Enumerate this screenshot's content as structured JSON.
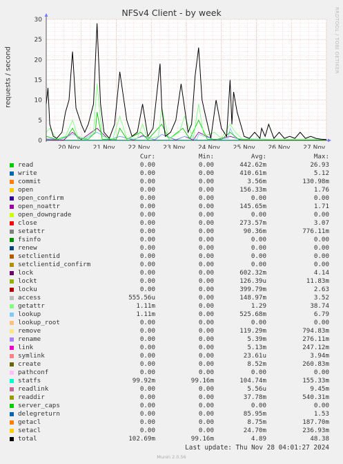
{
  "title": "NFSv4 Client - by week",
  "ylabel": "requests / second",
  "side_text": "RRDTOOL / TOBI OETIKER",
  "headers": {
    "cur": "Cur:",
    "min": "Min:",
    "avg": "Avg:",
    "max": "Max:"
  },
  "footer": "Last update: Thu Nov 28 04:01:27 2024",
  "version": "Munin 2.0.56",
  "legend": [
    {
      "name": "read",
      "color": "#00cc00",
      "cur": "0.00",
      "min": "0.00",
      "avg": "442.62m",
      "max": "26.93"
    },
    {
      "name": "write",
      "color": "#0066b3",
      "cur": "0.00",
      "min": "0.00",
      "avg": "410.61m",
      "max": "5.12"
    },
    {
      "name": "commit",
      "color": "#ff8000",
      "cur": "0.00",
      "min": "0.00",
      "avg": "3.56m",
      "max": "130.98m"
    },
    {
      "name": "open",
      "color": "#ffcc00",
      "cur": "0.00",
      "min": "0.00",
      "avg": "156.33m",
      "max": "1.76"
    },
    {
      "name": "open_confirm",
      "color": "#330099",
      "cur": "0.00",
      "min": "0.00",
      "avg": "0.00",
      "max": "0.00"
    },
    {
      "name": "open_noattr",
      "color": "#990099",
      "cur": "0.00",
      "min": "0.00",
      "avg": "145.65m",
      "max": "1.71"
    },
    {
      "name": "open_downgrade",
      "color": "#ccff00",
      "cur": "0.00",
      "min": "0.00",
      "avg": "0.00",
      "max": "0.00"
    },
    {
      "name": "close",
      "color": "#ff0000",
      "cur": "0.00",
      "min": "0.00",
      "avg": "273.57m",
      "max": "3.07"
    },
    {
      "name": "setattr",
      "color": "#808080",
      "cur": "0.00",
      "min": "0.00",
      "avg": "90.36m",
      "max": "776.11m"
    },
    {
      "name": "fsinfo",
      "color": "#008f00",
      "cur": "0.00",
      "min": "0.00",
      "avg": "0.00",
      "max": "0.00"
    },
    {
      "name": "renew",
      "color": "#00487d",
      "cur": "0.00",
      "min": "0.00",
      "avg": "0.00",
      "max": "0.00"
    },
    {
      "name": "setclientid",
      "color": "#b35a00",
      "cur": "0.00",
      "min": "0.00",
      "avg": "0.00",
      "max": "0.00"
    },
    {
      "name": "setclientid_confirm",
      "color": "#b38f00",
      "cur": "0.00",
      "min": "0.00",
      "avg": "0.00",
      "max": "0.00"
    },
    {
      "name": "lock",
      "color": "#6b006b",
      "cur": "0.00",
      "min": "0.00",
      "avg": "602.32m",
      "max": "4.14"
    },
    {
      "name": "lockt",
      "color": "#8fb300",
      "cur": "0.00",
      "min": "0.00",
      "avg": "126.39u",
      "max": "11.83m"
    },
    {
      "name": "locku",
      "color": "#b30000",
      "cur": "0.00",
      "min": "0.00",
      "avg": "399.79m",
      "max": "2.63"
    },
    {
      "name": "access",
      "color": "#bebebe",
      "cur": "555.56u",
      "min": "0.00",
      "avg": "148.97m",
      "max": "3.52"
    },
    {
      "name": "getattr",
      "color": "#80ff80",
      "cur": "1.11m",
      "min": "0.00",
      "avg": "1.29",
      "max": "38.74"
    },
    {
      "name": "lookup",
      "color": "#80c9ff",
      "cur": "1.11m",
      "min": "0.00",
      "avg": "525.68m",
      "max": "6.79"
    },
    {
      "name": "lookup_root",
      "color": "#ffc080",
      "cur": "0.00",
      "min": "0.00",
      "avg": "0.00",
      "max": "0.00"
    },
    {
      "name": "remove",
      "color": "#ffe680",
      "cur": "0.00",
      "min": "0.00",
      "avg": "119.29m",
      "max": "794.83m"
    },
    {
      "name": "rename",
      "color": "#aa80ff",
      "cur": "0.00",
      "min": "0.00",
      "avg": "5.39m",
      "max": "276.11m"
    },
    {
      "name": "link",
      "color": "#ee00cc",
      "cur": "0.00",
      "min": "0.00",
      "avg": "5.13m",
      "max": "247.12m"
    },
    {
      "name": "symlink",
      "color": "#ff8080",
      "cur": "0.00",
      "min": "0.00",
      "avg": "23.61u",
      "max": "3.94m"
    },
    {
      "name": "create",
      "color": "#666600",
      "cur": "0.00",
      "min": "0.00",
      "avg": "8.52m",
      "max": "260.83m"
    },
    {
      "name": "pathconf",
      "color": "#ffbfff",
      "cur": "0.00",
      "min": "0.00",
      "avg": "0.00",
      "max": "0.00"
    },
    {
      "name": "statfs",
      "color": "#00ffcc",
      "cur": "99.92m",
      "min": "99.16m",
      "avg": "104.74m",
      "max": "155.33m"
    },
    {
      "name": "readlink",
      "color": "#cc6699",
      "cur": "0.00",
      "min": "0.00",
      "avg": "5.56u",
      "max": "9.45m"
    },
    {
      "name": "readdir",
      "color": "#999900",
      "cur": "0.00",
      "min": "0.00",
      "avg": "37.78m",
      "max": "540.31m"
    },
    {
      "name": "server_caps",
      "color": "#00cc00",
      "cur": "0.00",
      "min": "0.00",
      "avg": "0.00",
      "max": "0.00"
    },
    {
      "name": "delegreturn",
      "color": "#0066b3",
      "cur": "0.00",
      "min": "0.00",
      "avg": "85.95m",
      "max": "1.53"
    },
    {
      "name": "getacl",
      "color": "#ff8000",
      "cur": "0.00",
      "min": "0.00",
      "avg": "8.75m",
      "max": "187.70m"
    },
    {
      "name": "setacl",
      "color": "#ffcc00",
      "cur": "0.00",
      "min": "0.00",
      "avg": "24.70m",
      "max": "236.93m"
    },
    {
      "name": "total",
      "color": "#000000",
      "cur": "102.69m",
      "min": "99.16m",
      "avg": "4.89",
      "max": "48.38"
    }
  ],
  "chart_data": {
    "type": "line",
    "title": "NFSv4 Client - by week",
    "ylabel": "requests / second",
    "ylim": [
      0,
      30
    ],
    "yticks": [
      0,
      5,
      10,
      15,
      20,
      25,
      30
    ],
    "categories": [
      "20 Nov",
      "21 Nov",
      "22 Nov",
      "23 Nov",
      "24 Nov",
      "25 Nov",
      "26 Nov",
      "27 Nov"
    ],
    "grid": true,
    "series": [
      {
        "name": "total",
        "color": "#000000",
        "x": [
          0.0,
          0.05,
          0.1,
          0.2,
          0.3,
          0.45,
          0.55,
          0.65,
          0.75,
          0.85,
          1.0,
          1.1,
          1.2,
          1.35,
          1.45,
          1.55,
          1.65,
          1.8,
          1.95,
          2.1,
          2.3,
          2.45,
          2.6,
          2.75,
          2.9,
          3.05,
          3.15,
          3.25,
          3.3,
          3.4,
          3.55,
          3.7,
          3.85,
          3.95,
          4.05,
          4.15,
          4.25,
          4.35,
          4.45,
          4.55,
          4.7,
          4.85,
          5.0,
          5.15,
          5.25,
          5.3,
          5.35,
          5.45,
          5.55,
          5.65,
          5.8,
          5.95,
          6.1,
          6.15,
          6.25,
          6.35,
          6.5,
          6.65,
          6.8,
          6.95,
          7.1,
          7.25,
          7.4,
          7.55,
          7.7,
          7.85,
          8.0
        ],
        "y": [
          9,
          13,
          4,
          1,
          0.5,
          2,
          7,
          10,
          22,
          8,
          4,
          2,
          4,
          9,
          29,
          9,
          2,
          0.5,
          4,
          17,
          5,
          1,
          2,
          9,
          1,
          3,
          11,
          19,
          8,
          1,
          2,
          5,
          14,
          8,
          2,
          4,
          16,
          23,
          10,
          6,
          0.5,
          10,
          3,
          1,
          15,
          4,
          12,
          7,
          4,
          1,
          0.5,
          2,
          0.5,
          3,
          1,
          4,
          0.5,
          2,
          0.5,
          1,
          0.5,
          2,
          0.5,
          1,
          0.5,
          0.3,
          0.2
        ]
      },
      {
        "name": "getattr",
        "color": "#80ff80",
        "x": [
          0.0,
          0.1,
          0.3,
          0.55,
          0.75,
          0.9,
          1.1,
          1.35,
          1.45,
          1.6,
          1.9,
          2.1,
          2.3,
          2.6,
          2.75,
          2.9,
          3.2,
          3.3,
          3.5,
          3.8,
          3.95,
          4.2,
          4.35,
          4.5,
          4.8,
          5.0,
          5.25,
          5.4,
          5.6,
          6.0,
          6.3,
          6.6,
          7.0,
          7.5,
          8.0
        ],
        "y": [
          2,
          3,
          0.3,
          1,
          5,
          1,
          0.5,
          2,
          14,
          1,
          0.3,
          6,
          0.5,
          0.5,
          4,
          0.3,
          1,
          8,
          0.3,
          2,
          6,
          0.5,
          9,
          1,
          2,
          0.5,
          4,
          2,
          0.3,
          0.5,
          0.3,
          0.4,
          0.3,
          0.4,
          0.2
        ]
      },
      {
        "name": "read",
        "color": "#00cc00",
        "x": [
          0.0,
          0.3,
          0.6,
          0.75,
          0.9,
          1.2,
          1.4,
          1.45,
          1.6,
          2.0,
          2.1,
          2.3,
          2.7,
          2.9,
          3.3,
          3.5,
          3.9,
          4.1,
          4.35,
          4.6,
          5.0,
          5.25,
          5.5,
          6.0,
          7.0,
          8.0
        ],
        "y": [
          1,
          0.2,
          1,
          3,
          0.5,
          0.3,
          2,
          7,
          0.3,
          0.2,
          3,
          0.3,
          2,
          0.2,
          4,
          0.3,
          3,
          0.4,
          5,
          0.3,
          0.2,
          2,
          0.2,
          0.1,
          0.1,
          0.1
        ]
      },
      {
        "name": "lookup",
        "color": "#80c9ff",
        "x": [
          0.0,
          0.4,
          0.75,
          1.1,
          1.45,
          1.8,
          2.1,
          2.5,
          2.75,
          3.1,
          3.3,
          3.7,
          3.95,
          4.3,
          4.35,
          4.8,
          5.2,
          5.25,
          5.4,
          5.8,
          6.5,
          7.5,
          8.0
        ],
        "y": [
          0.5,
          0.2,
          1.5,
          0.3,
          2,
          0.2,
          1,
          0.2,
          1,
          0.2,
          1.5,
          0.2,
          1,
          0.2,
          1.5,
          0.2,
          0.5,
          3,
          0.5,
          0.2,
          0.1,
          0.1,
          0.1
        ]
      },
      {
        "name": "lock",
        "color": "#990099",
        "x": [
          0.0,
          0.5,
          0.75,
          1.0,
          1.45,
          1.8,
          2.1,
          2.5,
          2.75,
          3.1,
          3.3,
          3.7,
          3.95,
          4.2,
          4.35,
          4.8,
          5.25,
          5.6,
          6.5,
          8.0
        ],
        "y": [
          0.2,
          0.1,
          2,
          0.2,
          3,
          0.1,
          1,
          0.1,
          1.2,
          0.1,
          1.5,
          0.1,
          1,
          0.1,
          2,
          0.1,
          1,
          0.1,
          0.05,
          0.05
        ]
      },
      {
        "name": "statfs",
        "color": "#00ffcc",
        "x": [
          0.0,
          8.0
        ],
        "y": [
          0.1,
          0.1
        ]
      }
    ]
  }
}
